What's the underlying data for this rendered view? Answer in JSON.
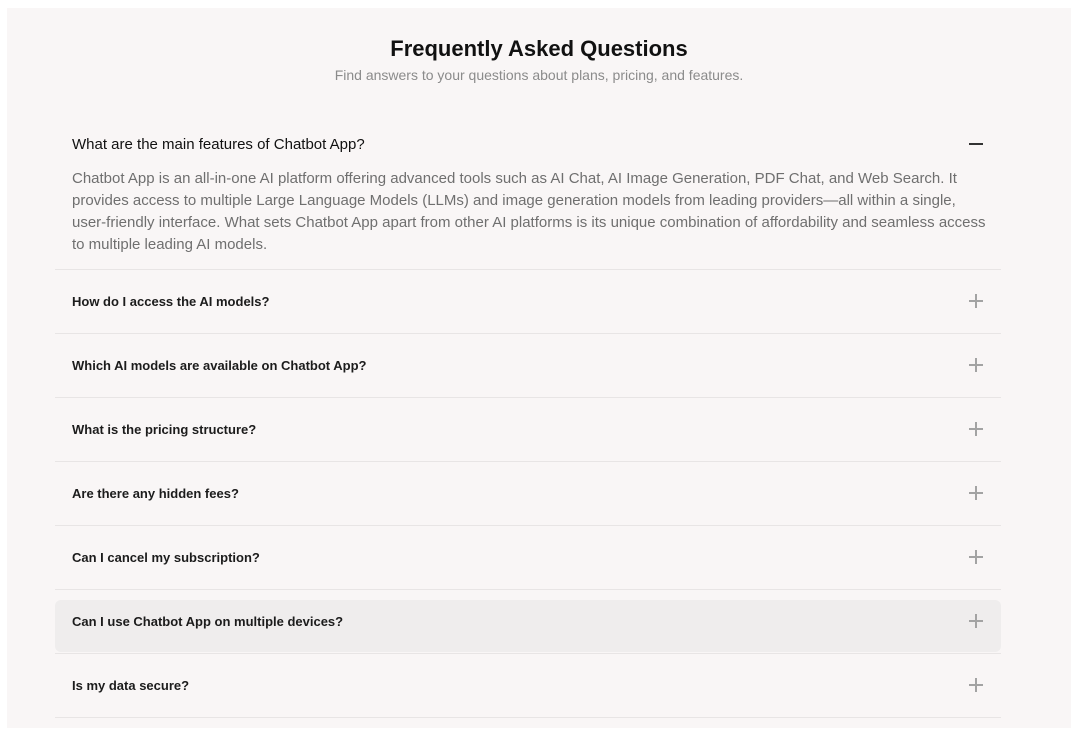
{
  "header": {
    "title": "Frequently Asked Questions",
    "subtitle": "Find answers to your questions about plans, pricing, and features."
  },
  "faq": {
    "open_item": {
      "question": "What are the main features of Chatbot App?",
      "answer": "Chatbot App is an all-in-one AI platform offering advanced tools such as AI Chat, AI Image Generation, PDF Chat, and Web Search. It provides access to multiple Large Language Models (LLMs) and image generation models from leading providers—all within a single, user-friendly interface. What sets Chatbot App apart from other AI platforms is its unique combination of affordability and seamless access to multiple leading AI models.",
      "icon": "minus-icon"
    },
    "items": [
      {
        "question": "How do I access the AI models?",
        "icon": "plus-icon"
      },
      {
        "question": "Which AI models are available on Chatbot App?",
        "icon": "plus-icon"
      },
      {
        "question": "What is the pricing structure?",
        "icon": "plus-icon"
      },
      {
        "question": "Are there any hidden fees?",
        "icon": "plus-icon"
      },
      {
        "question": "Can I cancel my subscription?",
        "icon": "plus-icon"
      },
      {
        "question": "Can I use Chatbot App on multiple devices?",
        "icon": "plus-icon",
        "hovered": true
      },
      {
        "question": "Is my data secure?",
        "icon": "plus-icon"
      }
    ]
  },
  "colors": {
    "page_background": "#f9f6f6",
    "hover_row": "#efeded",
    "divider": "#e8e5e5",
    "muted_text": "#8b8b8b"
  }
}
